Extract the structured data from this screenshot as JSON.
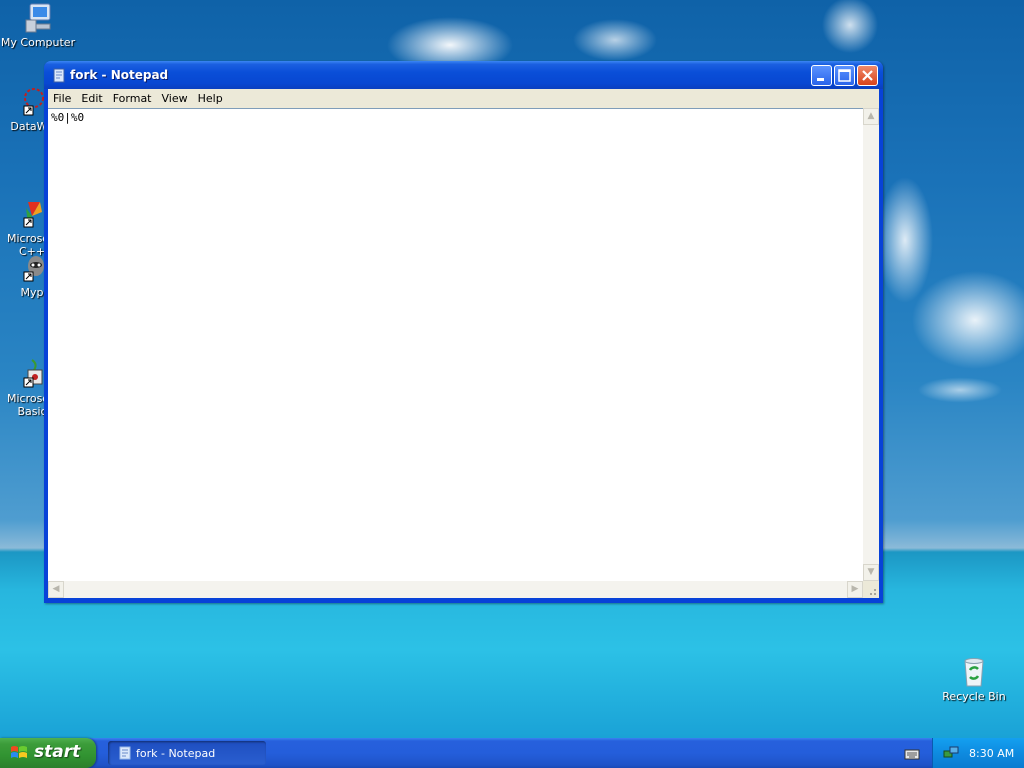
{
  "desktop": {
    "icons": [
      {
        "label": "My Computer"
      },
      {
        "label": "DataWa"
      },
      {
        "label": "Microsoft\nC++"
      },
      {
        "label": "Myp"
      },
      {
        "label": "Microsoft\nBasic"
      },
      {
        "label": "Recycle Bin"
      }
    ]
  },
  "window": {
    "title": "fork - Notepad",
    "menu": [
      "File",
      "Edit",
      "Format",
      "View",
      "Help"
    ],
    "content": "%0|%0"
  },
  "taskbar": {
    "start_label": "start",
    "task_label": "fork - Notepad",
    "clock": "8:30 AM"
  },
  "colors": {
    "titlebar": "#0a4fd8",
    "start_green": "#319331",
    "taskbar_blue": "#245edb",
    "tray_blue": "#0e8be0"
  }
}
